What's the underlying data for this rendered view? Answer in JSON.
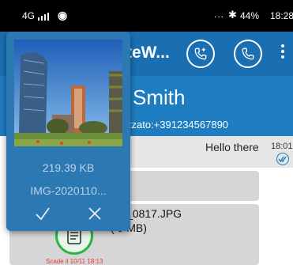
{
  "status_bar": {
    "network": "4G",
    "more": "...",
    "battery": "44%",
    "time": "18:28"
  },
  "app_bar": {
    "title": "teW..."
  },
  "contact": {
    "name": "Smith",
    "phone": "zzato:+391234567890"
  },
  "chat": {
    "incoming_text": "Hello there",
    "incoming_time": "18:01",
    "file_name": "_0817.JPG",
    "file_size": "(  9 MB)",
    "expiry": "Scade il 10/11 18:13"
  },
  "popup": {
    "size": "219.39 KB",
    "name": "IMG-2020110..."
  },
  "colors": {
    "status_bar": "#000000",
    "app_bar": "#1a6fb3",
    "contact_header": "#1e7dc0",
    "popup": "#2c78b2",
    "bubble": "#d6d6d6",
    "accent_green": "#2db34a",
    "expiry_red": "#e53935"
  },
  "icons": [
    "phone-plus-icon",
    "phone-icon",
    "overflow-menu-icon",
    "read-receipt-icon",
    "document-icon",
    "check-icon",
    "close-icon"
  ]
}
